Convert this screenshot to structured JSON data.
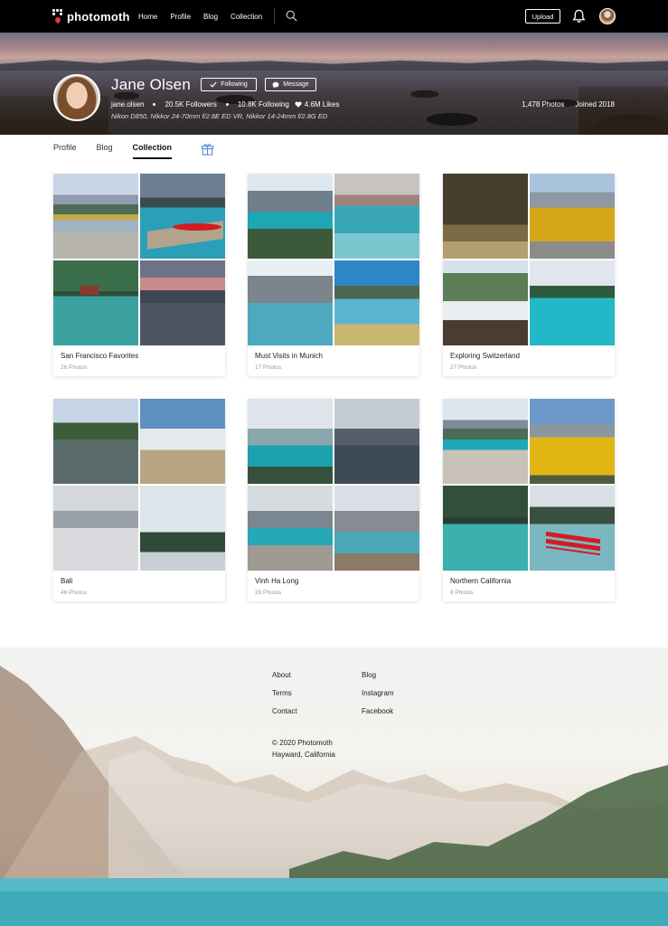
{
  "nav": {
    "brand": "photomoth",
    "links": [
      "Home",
      "Profile",
      "Blog",
      "Collection"
    ],
    "upload_label": "Upload"
  },
  "profile": {
    "name": "Jane Olsen",
    "following_label": "Following",
    "message_label": "Message",
    "username": "jane.olsen",
    "followers": "20.5K Followers",
    "following": "10.8K Following",
    "likes": "4.6M Likes",
    "gear": "Nikon D850, Nikkor 24-70mm f/2.8E ED VR, Nikkor 14-24mm f/2.8G ED",
    "photos": "1,478 Photos",
    "joined": "Joined 2018"
  },
  "tabs": [
    "Profile",
    "Blog",
    "Collection"
  ],
  "active_tab": "Collection",
  "collections": [
    {
      "title": "San Francisco Favorites",
      "count": "26 Photos"
    },
    {
      "title": "Must Visits in Munich",
      "count": "17 Photos"
    },
    {
      "title": "Exploring Switzerland",
      "count": "27 Photos"
    },
    {
      "title": "Bali",
      "count": "46 Photos"
    },
    {
      "title": "Vinh Ha Long",
      "count": "28 Photos"
    },
    {
      "title": "Northern California",
      "count": "8 Photos"
    }
  ],
  "footer": {
    "col1": [
      "About",
      "Terms",
      "Contact"
    ],
    "col2": [
      "Blog",
      "Instagram",
      "Facebook"
    ],
    "copyright": "© 2020 Photomoth",
    "location": "Hayward, California"
  }
}
